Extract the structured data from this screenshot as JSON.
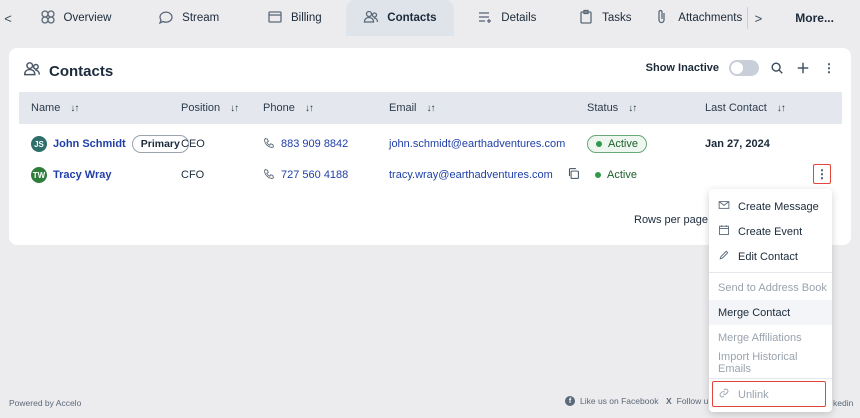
{
  "tabs": [
    {
      "label": "Overview",
      "icon": "overview-icon"
    },
    {
      "label": "Stream",
      "icon": "stream-icon"
    },
    {
      "label": "Billing",
      "icon": "billing-icon"
    },
    {
      "label": "Contacts",
      "icon": "contacts-icon",
      "active": true
    },
    {
      "label": "Details",
      "icon": "details-icon"
    },
    {
      "label": "Tasks",
      "icon": "tasks-icon"
    },
    {
      "label": "Attachments",
      "icon": "attachments-icon"
    }
  ],
  "tab_prev": "<",
  "tab_next": ">",
  "more_label": "More...",
  "card": {
    "title": "Contacts",
    "show_inactive_label": "Show Inactive",
    "show_inactive": false
  },
  "table": {
    "columns": [
      "Name",
      "Position",
      "Phone",
      "Email",
      "Status",
      "Last Contact"
    ],
    "sort_glyph": "↓↑",
    "rows": [
      {
        "initials": "JS",
        "avatar_color": "#2f6f6a",
        "name": "John Schmidt",
        "badge": "Primary",
        "position": "CEO",
        "phone": "883 909 8842",
        "email": "john.schmidt@earthadventures.com",
        "status": "Active",
        "last_contact": "Jan 27, 2024"
      },
      {
        "initials": "TW",
        "avatar_color": "#2f7d3b",
        "name": "Tracy Wray",
        "badge": "",
        "position": "CFO",
        "phone": "727 560 4188",
        "email": "tracy.wray@earthadventures.com",
        "status": "Active",
        "last_contact": ""
      }
    ]
  },
  "rows_per_page_label": "Rows per page:",
  "kebab_glyph": "⋮",
  "menu": {
    "items": [
      {
        "label": "Create Message",
        "icon": "mail-icon",
        "disabled": false
      },
      {
        "label": "Create Event",
        "icon": "calendar-icon",
        "disabled": false
      },
      {
        "label": "Edit Contact",
        "icon": "pencil-icon",
        "disabled": false
      },
      {
        "label": "Send to Address Book",
        "disabled": true
      },
      {
        "label": "Merge Contact",
        "disabled": false
      },
      {
        "label": "Merge Affiliations",
        "disabled": true
      },
      {
        "label": "Import Historical Emails",
        "disabled": true
      },
      {
        "label": "Unlink",
        "icon": "link-icon",
        "disabled": true
      }
    ]
  },
  "footer": {
    "powered_by": "Powered by Accelo",
    "facebook": "Like us on Facebook",
    "x_follow": "Follow u",
    "x_glyph": "X",
    "fb_glyph": "f",
    "linkedin": "kedin"
  },
  "colors": {
    "accent": "#1f3fa8",
    "active_green": "#2f9b4a",
    "highlight_red": "#e2463a"
  }
}
